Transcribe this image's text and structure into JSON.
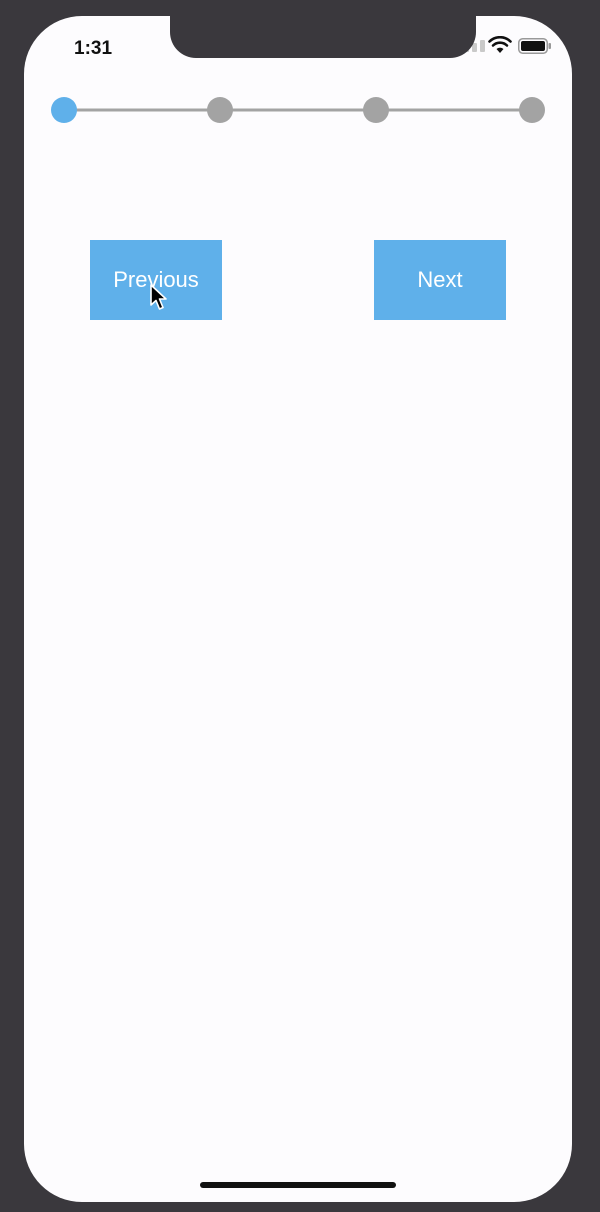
{
  "status_bar": {
    "time": "1:31",
    "icons": [
      "signal-icon",
      "wifi-icon",
      "battery-icon"
    ]
  },
  "stepper": {
    "total_steps": 4,
    "current_step": 1,
    "active_color": "#5fb0ea",
    "inactive_color": "#a3a3a3"
  },
  "buttons": {
    "previous_label": "Previous",
    "next_label": "Next",
    "color": "#5fb0ea"
  }
}
